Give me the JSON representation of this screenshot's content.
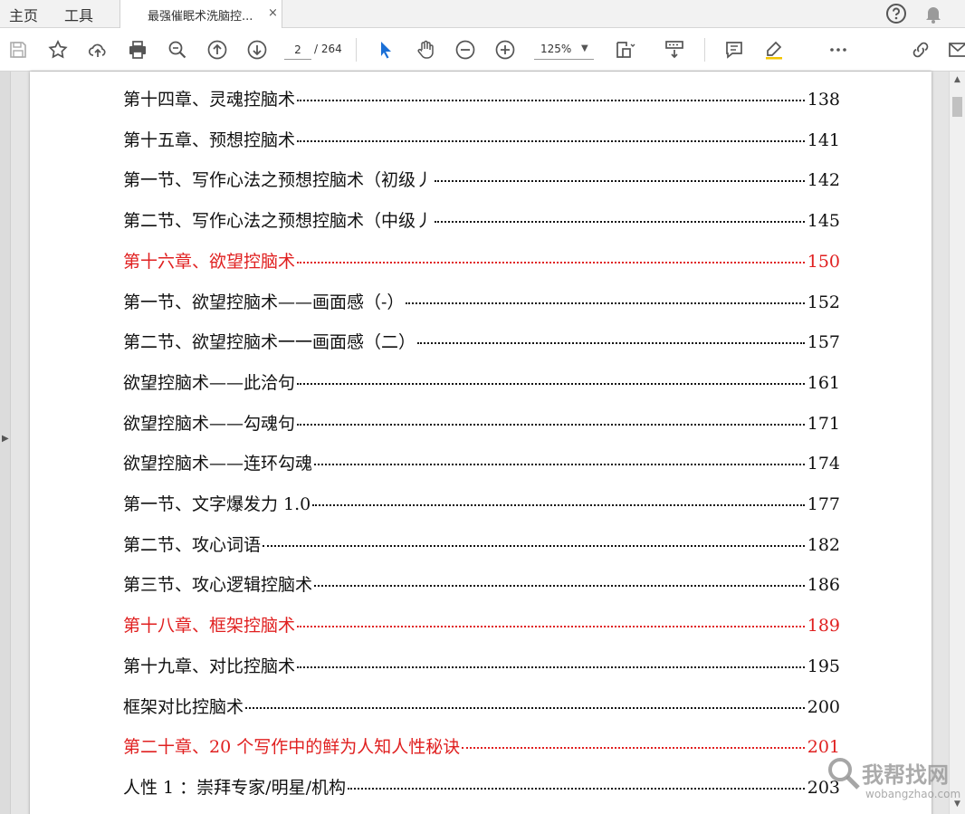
{
  "tabs": {
    "home_label": "主页",
    "tools_label": "工具",
    "document_title": "最强催眠术洗脑控...",
    "close_glyph": "×"
  },
  "toolbar": {
    "current_page": "2",
    "page_total": "/ 264",
    "zoom": "125%",
    "zoom_caret": "▼",
    "icons": [
      "save-icon",
      "bookmark-star-icon",
      "upload-cloud-icon",
      "print-icon",
      "zoom-search-icon",
      "previous-page-icon",
      "next-page-icon",
      "select-cursor-icon",
      "hand-tool-icon",
      "zoom-out-icon",
      "zoom-in-icon",
      "fit-page-icon",
      "scroll-mode-icon",
      "comment-icon",
      "highlight-pen-icon",
      "more-icon",
      "share-link-icon",
      "email-icon"
    ]
  },
  "top_icons": [
    "help-icon",
    "notifications-bell-icon"
  ],
  "toc": {
    "accent_color": "#e02020",
    "entries": [
      {
        "title": "第十四章、灵魂控脑术",
        "page": "138",
        "highlight": false
      },
      {
        "title": "第十五章、预想控脑术",
        "page": "141",
        "highlight": false
      },
      {
        "title": "第一节、写作心法之预想控脑术（初级丿",
        "page": "142",
        "highlight": false
      },
      {
        "title": "第二节、写作心法之预想控脑术（中级丿",
        "page": "145",
        "highlight": false
      },
      {
        "title": "第十六章、欲望控脑术",
        "page": "150",
        "highlight": true
      },
      {
        "title": "第一节、欲望控脑术——画面感（-）",
        "page": "152",
        "highlight": false
      },
      {
        "title": "第二节、欲望控脑术一一画面感（二）",
        "page": "157",
        "highlight": false
      },
      {
        "title": "欲望控脑术——此洽句",
        "page": "161",
        "highlight": false
      },
      {
        "title": "欲望控脑术——勾魂句",
        "page": "171",
        "highlight": false
      },
      {
        "title": "欲望控脑术——连环勾魂",
        "page": "174",
        "highlight": false
      },
      {
        "title": "第一节、文字爆发力 1.0",
        "page": "177",
        "highlight": false
      },
      {
        "title": "第二节、攻心词语",
        "page": "182",
        "highlight": false
      },
      {
        "title": "第三节、攻心逻辑控脑术",
        "page": "186",
        "highlight": false
      },
      {
        "title": "第十八章、框架控脑术",
        "page": "189",
        "highlight": true
      },
      {
        "title": "第十九章、对比控脑术",
        "page": "195",
        "highlight": false
      },
      {
        "title": "框架对比控脑术",
        "page": "200",
        "highlight": false
      },
      {
        "title": "第二十章、20 个写作中的鲜为人知人性秘诀",
        "page": "201",
        "highlight": true
      },
      {
        "title": "人性 1 ：崇拜专家/明星/机构",
        "page": "203",
        "highlight": false
      }
    ]
  },
  "watermark": {
    "text_cn": "我帮找网",
    "text_en": "wobangzhao.com"
  },
  "scrollbar": {
    "up_glyph": "▲",
    "down_glyph": "▼"
  },
  "left_panel": {
    "expand_glyph": "▶"
  }
}
